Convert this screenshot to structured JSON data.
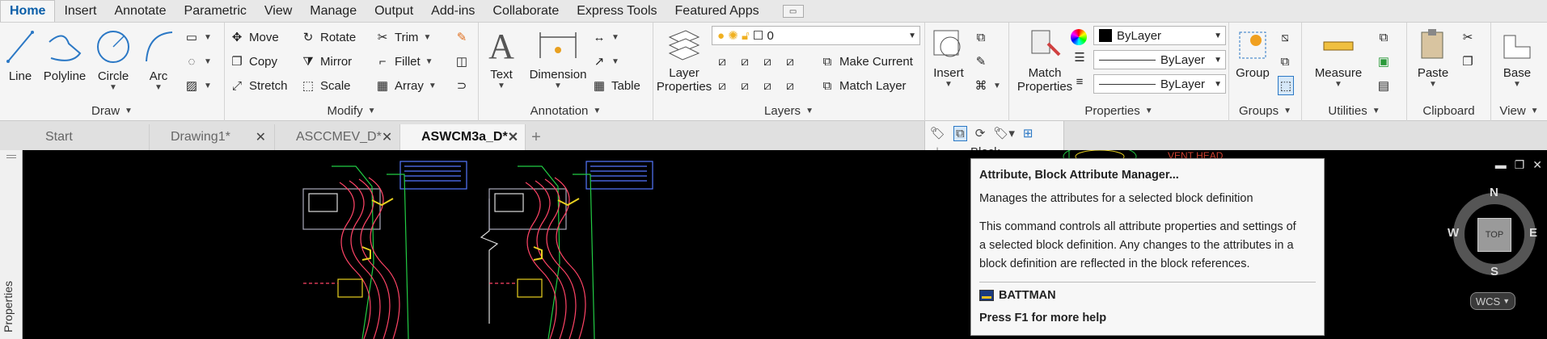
{
  "ribbon_tabs": [
    "Home",
    "Insert",
    "Annotate",
    "Parametric",
    "View",
    "Manage",
    "Output",
    "Add-ins",
    "Collaborate",
    "Express Tools",
    "Featured Apps"
  ],
  "panels": {
    "draw": {
      "title": "Draw",
      "line": "Line",
      "polyline": "Polyline",
      "circle": "Circle",
      "arc": "Arc"
    },
    "modify": {
      "title": "Modify",
      "move": "Move",
      "rotate": "Rotate",
      "trim": "Trim",
      "copy": "Copy",
      "mirror": "Mirror",
      "fillet": "Fillet",
      "stretch": "Stretch",
      "scale": "Scale",
      "array": "Array"
    },
    "annotation": {
      "title": "Annotation",
      "text": "Text",
      "dimension": "Dimension",
      "table": "Table"
    },
    "layers": {
      "title": "Layers",
      "layer_properties_1": "Layer",
      "layer_properties_2": "Properties",
      "current_layer": "0",
      "make_current": "Make Current",
      "match_layer": "Match Layer"
    },
    "block": {
      "title": "Block",
      "insert": "Insert"
    },
    "properties": {
      "title": "Properties",
      "match_1": "Match",
      "match_2": "Properties",
      "color": "ByLayer",
      "linetype": "ByLayer",
      "lineweight": "ByLayer"
    },
    "groups": {
      "title": "Groups",
      "group": "Group"
    },
    "utilities": {
      "title": "Utilities",
      "measure": "Measure"
    },
    "clipboard": {
      "title": "Clipboard",
      "paste": "Paste"
    },
    "view": {
      "title": "View",
      "base": "Base"
    }
  },
  "file_tabs": [
    {
      "label": "Start",
      "closable": false
    },
    {
      "label": "Drawing1*",
      "closable": true
    },
    {
      "label": "ASCCMEV_D*",
      "closable": true
    },
    {
      "label": "ASWCM3a_D*",
      "closable": true
    }
  ],
  "side_palette_label": "Properties",
  "drawing_text": "VENT HEAD",
  "tooltip": {
    "title": "Attribute, Block Attribute Manager...",
    "summary": "Manages the attributes for a selected block definition",
    "detail_1": "This command controls all attribute properties and settings of",
    "detail_2": "a selected block definition. Any changes to the attributes in a",
    "detail_3": "block definition are reflected in the block references.",
    "command": "BATTMAN",
    "help": "Press F1 for more help"
  },
  "viewcube": {
    "n": "N",
    "s": "S",
    "e": "E",
    "w": "W",
    "face": "TOP",
    "ucs": "WCS"
  },
  "colors": {
    "accent": "#0a5ea8",
    "drawing_red": "#ff4466",
    "drawing_green": "#22cc44",
    "drawing_blue": "#5577ff",
    "drawing_yellow": "#e8d020"
  }
}
